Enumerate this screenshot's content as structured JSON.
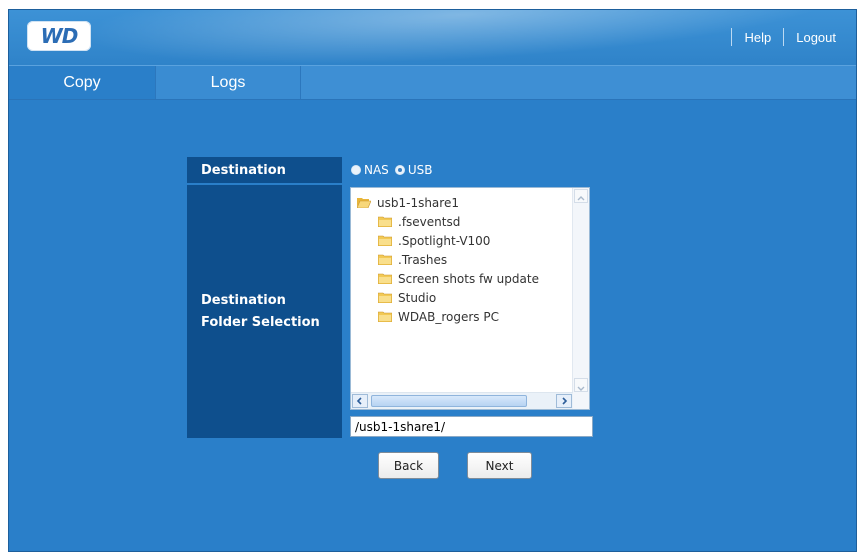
{
  "header": {
    "logo_text": "WD",
    "links": {
      "help": "Help",
      "logout": "Logout"
    }
  },
  "tabs": [
    {
      "label": "Copy",
      "active": true
    },
    {
      "label": "Logs",
      "active": false
    }
  ],
  "form": {
    "destination_label": "Destination",
    "folder_label_line1": "Destination",
    "folder_label_line2": "Folder Selection",
    "destination_options": [
      {
        "label": "NAS",
        "selected": false
      },
      {
        "label": "USB",
        "selected": true
      }
    ]
  },
  "tree": {
    "root": "usb1-1share1",
    "children": [
      ".fseventsd",
      ".Spotlight-V100",
      ".Trashes",
      "Screen shots fw update",
      "Studio",
      "WDAB_rogers PC"
    ]
  },
  "path_value": "/usb1-1share1/",
  "buttons": {
    "back": "Back",
    "next": "Next"
  },
  "colors": {
    "background": "#2a7fc9",
    "label_panel": "#0e4f8d",
    "tab_bar": "#3e8fd4"
  }
}
